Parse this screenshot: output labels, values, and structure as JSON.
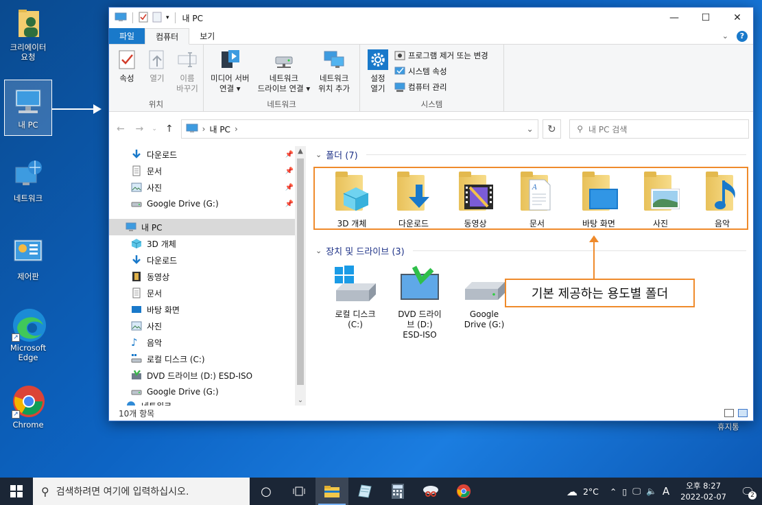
{
  "desktop": {
    "icons": [
      {
        "label": "크리에이터\n요청",
        "icon": "user-folder-icon"
      },
      {
        "label": "내 PC",
        "icon": "computer-icon"
      },
      {
        "label": "네트워크",
        "icon": "network-icon"
      },
      {
        "label": "제어판",
        "icon": "control-panel-icon"
      },
      {
        "label": "Microsoft\nEdge",
        "icon": "edge-icon"
      },
      {
        "label": "Chrome",
        "icon": "chrome-icon"
      }
    ],
    "recycle_label": "휴지통"
  },
  "window": {
    "title": "내 PC",
    "controls": {
      "minimize": "—",
      "maximize": "☐",
      "close": "✕"
    },
    "ribbon_tabs": [
      "파일",
      "컴퓨터",
      "보기"
    ],
    "ribbon": {
      "groups": [
        {
          "label": "위치",
          "buttons": [
            {
              "label": "속성",
              "icon": "properties-icon"
            },
            {
              "label": "열기",
              "icon": "open-icon",
              "disabled": true
            },
            {
              "label": "이름\n바꾸기",
              "icon": "rename-icon",
              "disabled": true
            }
          ]
        },
        {
          "label": "네트워크",
          "buttons": [
            {
              "label": "미디어 서버\n연결 ▾",
              "icon": "media-server-icon"
            },
            {
              "label": "네트워크\n드라이브 연결 ▾",
              "icon": "map-drive-icon"
            },
            {
              "label": "네트워크\n위치 추가",
              "icon": "network-location-icon"
            }
          ]
        },
        {
          "label": "시스템",
          "big": {
            "label": "설정\n열기",
            "icon": "settings-gear-icon"
          },
          "small": [
            {
              "label": "프로그램 제거 또는 변경",
              "icon": "uninstall-icon"
            },
            {
              "label": "시스템 속성",
              "icon": "system-properties-icon"
            },
            {
              "label": "컴퓨터 관리",
              "icon": "computer-management-icon"
            }
          ]
        }
      ]
    },
    "address": {
      "path": "내 PC",
      "separator": "›"
    },
    "search": {
      "placeholder": "내 PC 검색"
    },
    "nav": {
      "quick_access": [
        {
          "label": "다운로드",
          "icon": "download-icon",
          "pinned": true
        },
        {
          "label": "문서",
          "icon": "document-icon",
          "pinned": true
        },
        {
          "label": "사진",
          "icon": "picture-icon",
          "pinned": true
        },
        {
          "label": "Google Drive (G:)",
          "icon": "drive-icon",
          "pinned": true
        }
      ],
      "this_pc": {
        "label": "내 PC",
        "icon": "computer-icon"
      },
      "this_pc_items": [
        {
          "label": "3D 개체",
          "icon": "3d-objects-icon"
        },
        {
          "label": "다운로드",
          "icon": "download-icon"
        },
        {
          "label": "동영상",
          "icon": "video-icon"
        },
        {
          "label": "문서",
          "icon": "document-icon"
        },
        {
          "label": "바탕 화면",
          "icon": "desktop-icon"
        },
        {
          "label": "사진",
          "icon": "picture-icon"
        },
        {
          "label": "음악",
          "icon": "music-icon"
        },
        {
          "label": "로컬 디스크 (C:)",
          "icon": "local-disk-icon"
        },
        {
          "label": "DVD 드라이브 (D:) ESD-ISO",
          "icon": "dvd-drive-icon"
        },
        {
          "label": "Google Drive (G:)",
          "icon": "drive-icon"
        }
      ],
      "network": {
        "label": "네트워크",
        "icon": "network-icon"
      }
    },
    "folders_section": {
      "title": "폴더 (7)"
    },
    "folders": [
      {
        "label": "3D 개체",
        "icon": "3d-objects-folder-icon"
      },
      {
        "label": "다운로드",
        "icon": "downloads-folder-icon"
      },
      {
        "label": "동영상",
        "icon": "videos-folder-icon"
      },
      {
        "label": "문서",
        "icon": "documents-folder-icon"
      },
      {
        "label": "바탕 화면",
        "icon": "desktop-folder-icon"
      },
      {
        "label": "사진",
        "icon": "pictures-folder-icon"
      },
      {
        "label": "음악",
        "icon": "music-folder-icon"
      }
    ],
    "devices_section": {
      "title": "장치 및 드라이브 (3)"
    },
    "drives": [
      {
        "label": "로컬 디스크\n(C:)",
        "icon": "windows-drive-icon"
      },
      {
        "label": "DVD 드라이\n브 (D:)\nESD-ISO",
        "icon": "dvd-drive-icon"
      },
      {
        "label": "Google\nDrive (G:)",
        "icon": "drive-icon"
      }
    ],
    "callout": "기본 제공하는 용도별 폴더",
    "status": "10개 항목"
  },
  "taskbar": {
    "search_placeholder": "검색하려면 여기에 입력하십시오.",
    "weather": "2°C",
    "ime": "A",
    "time": "오후 8:27",
    "date": "2022-02-07",
    "notifications": "2",
    "accent": "#1979ca",
    "callout_color": "#ef8a2a"
  }
}
